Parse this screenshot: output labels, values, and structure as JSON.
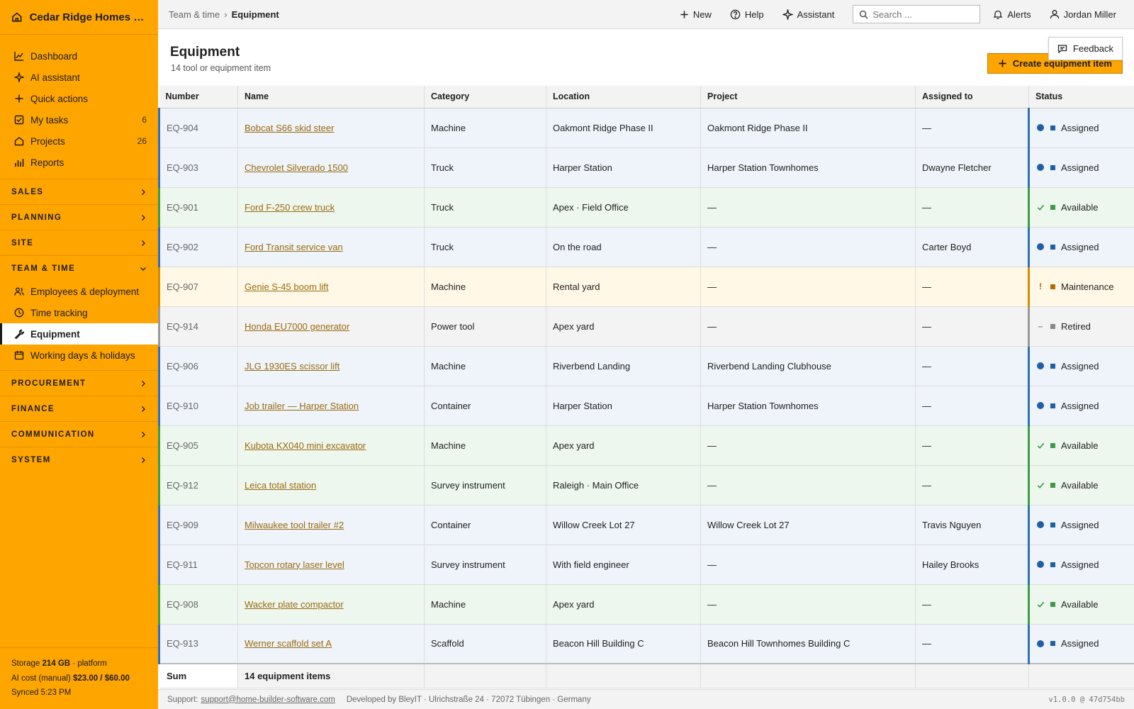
{
  "app": {
    "company": "Cedar Ridge Homes L..."
  },
  "sidebar": {
    "top_items": [
      {
        "label": "Dashboard",
        "icon": "chart-line-icon",
        "count": ""
      },
      {
        "label": "AI assistant",
        "icon": "sparkle-icon",
        "count": ""
      },
      {
        "label": "Quick actions",
        "icon": "plus-icon",
        "count": ""
      },
      {
        "label": "My tasks",
        "icon": "checkbox-icon",
        "count": "6"
      },
      {
        "label": "Projects",
        "icon": "home-icon",
        "count": "26"
      },
      {
        "label": "Reports",
        "icon": "bar-chart-icon",
        "count": ""
      }
    ],
    "groups": {
      "sales": "SALES",
      "planning": "PLANNING",
      "site": "SITE",
      "team_time": "TEAM & TIME",
      "procurement": "PROCUREMENT",
      "finance": "FINANCE",
      "communication": "COMMUNICATION",
      "system": "SYSTEM"
    },
    "team_items": [
      {
        "label": "Employees & deployment",
        "icon": "users-icon"
      },
      {
        "label": "Time tracking",
        "icon": "clock-icon"
      },
      {
        "label": "Equipment",
        "icon": "wrench-icon",
        "active": true
      },
      {
        "label": "Working days & holidays",
        "icon": "calendar-icon"
      }
    ],
    "footer": {
      "storage_label": "Storage",
      "storage_value": "214 GB",
      "storage_suffix": "· platform",
      "ai_cost_label": "AI cost (manual)",
      "ai_cost_value": "$23.00 / $60.00",
      "synced": "Synced 5:23 PM"
    }
  },
  "topbar": {
    "breadcrumb_parent": "Team & time",
    "breadcrumb_sep": "›",
    "breadcrumb_current": "Equipment",
    "new_label": "New",
    "help_label": "Help",
    "assistant_label": "Assistant",
    "search_placeholder": "Search ...",
    "alerts_label": "Alerts",
    "user_name": "Jordan Miller"
  },
  "page": {
    "title": "Equipment",
    "subtitle": "14 tool or equipment item",
    "create_label": "Create equipment item",
    "feedback_label": "Feedback"
  },
  "table": {
    "columns": [
      "Number",
      "Name",
      "Category",
      "Location",
      "Project",
      "Assigned to",
      "Status"
    ],
    "rows": [
      {
        "number": "EQ-904",
        "name": "Bobcat S66 skid steer",
        "category": "Machine",
        "location": "Oakmont Ridge Phase II",
        "project": "Oakmont Ridge Phase II",
        "assigned": "—",
        "status": "Assigned",
        "state": "assigned"
      },
      {
        "number": "EQ-903",
        "name": "Chevrolet Silverado 1500",
        "category": "Truck",
        "location": "Harper Station",
        "project": "Harper Station Townhomes",
        "assigned": "Dwayne Fletcher",
        "status": "Assigned",
        "state": "assigned"
      },
      {
        "number": "EQ-901",
        "name": "Ford F-250 crew truck",
        "category": "Truck",
        "location": "Apex · Field Office",
        "project": "—",
        "assigned": "—",
        "status": "Available",
        "state": "available"
      },
      {
        "number": "EQ-902",
        "name": "Ford Transit service van",
        "category": "Truck",
        "location": "On the road",
        "project": "—",
        "assigned": "Carter Boyd",
        "status": "Assigned",
        "state": "assigned"
      },
      {
        "number": "EQ-907",
        "name": "Genie S-45 boom lift",
        "category": "Machine",
        "location": "Rental yard",
        "project": "—",
        "assigned": "—",
        "status": "Maintenance",
        "state": "maintenance"
      },
      {
        "number": "EQ-914",
        "name": "Honda EU7000 generator",
        "category": "Power tool",
        "location": "Apex yard",
        "project": "—",
        "assigned": "—",
        "status": "Retired",
        "state": "retired"
      },
      {
        "number": "EQ-906",
        "name": "JLG 1930ES scissor lift",
        "category": "Machine",
        "location": "Riverbend Landing",
        "project": "Riverbend Landing Clubhouse",
        "assigned": "—",
        "status": "Assigned",
        "state": "assigned"
      },
      {
        "number": "EQ-910",
        "name": "Job trailer — Harper Station",
        "category": "Container",
        "location": "Harper Station",
        "project": "Harper Station Townhomes",
        "assigned": "—",
        "status": "Assigned",
        "state": "assigned"
      },
      {
        "number": "EQ-905",
        "name": "Kubota KX040 mini excavator",
        "category": "Machine",
        "location": "Apex yard",
        "project": "—",
        "assigned": "—",
        "status": "Available",
        "state": "available"
      },
      {
        "number": "EQ-912",
        "name": "Leica total station",
        "category": "Survey instrument",
        "location": "Raleigh · Main Office",
        "project": "—",
        "assigned": "—",
        "status": "Available",
        "state": "available"
      },
      {
        "number": "EQ-909",
        "name": "Milwaukee tool trailer #2",
        "category": "Container",
        "location": "Willow Creek Lot 27",
        "project": "Willow Creek Lot 27",
        "assigned": "Travis Nguyen",
        "status": "Assigned",
        "state": "assigned"
      },
      {
        "number": "EQ-911",
        "name": "Topcon rotary laser level",
        "category": "Survey instrument",
        "location": "With field engineer",
        "project": "—",
        "assigned": "Hailey Brooks",
        "status": "Assigned",
        "state": "assigned"
      },
      {
        "number": "EQ-908",
        "name": "Wacker plate compactor",
        "category": "Machine",
        "location": "Apex yard",
        "project": "—",
        "assigned": "—",
        "status": "Available",
        "state": "available"
      },
      {
        "number": "EQ-913",
        "name": "Werner scaffold set A",
        "category": "Scaffold",
        "location": "Beacon Hill Building C",
        "project": "Beacon Hill Townhomes Building C",
        "assigned": "—",
        "status": "Assigned",
        "state": "assigned"
      }
    ],
    "sum_label": "Sum",
    "sum_value": "14 equipment items"
  },
  "footer": {
    "support_label": "Support:",
    "support_email": "support@home-builder-software.com",
    "developer": "Developed by BleyIT · Ulrichstraße 24 · 72072 Tübingen · Germany",
    "version": "v1.0.0 @ 47d754bb"
  },
  "colors": {
    "brand": "#FFA500",
    "assigned": "#1f5fa5",
    "available": "#3d9a45",
    "maintenance": "#d68a00",
    "retired": "#999999"
  }
}
